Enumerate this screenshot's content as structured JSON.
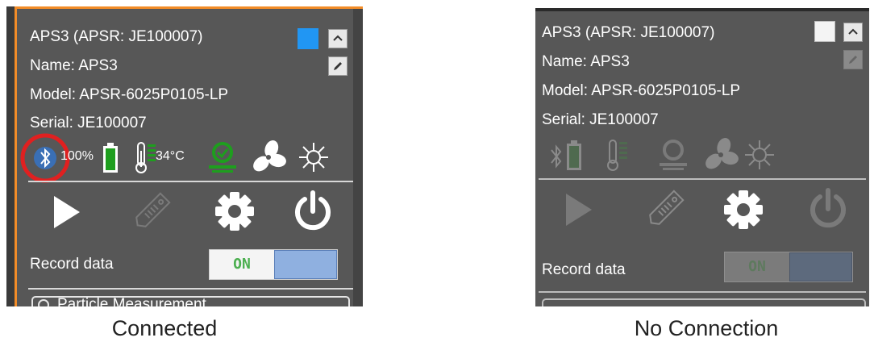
{
  "connected": {
    "title": "APS3 (APSR: JE100007)",
    "name": "Name:  APS3",
    "model": "Model: APSR-6025P0105-LP",
    "serial": "Serial:  JE100007",
    "battery": "100%",
    "temperature": "34°C",
    "record_label": "Record data",
    "toggle_label": "ON",
    "bottom_label": "Particle Measurement",
    "caption": "Connected",
    "colors": {
      "panel": "#575757",
      "accent_orange": "#f28c28",
      "color_square": "#2196f3",
      "bluetooth": "#3b82f6",
      "annotation": "#e02020",
      "status_green": "#1a9a1a",
      "toggle_on_text": "#4caf50",
      "toggle_knob": "#8fb0e0"
    }
  },
  "disconnected": {
    "title": "APS3 (APSR: JE100007)",
    "name": "Name:  APS3",
    "model": "Model: APSR-6025P0105-LP",
    "serial": "Serial:  JE100007",
    "record_label": "Record data",
    "toggle_label": "ON",
    "caption": "No Connection",
    "colors": {
      "panel": "#575757",
      "color_square": "#f4f4f4",
      "dim_green": "#4f6a4f",
      "toggle_knob": "#5d6a7d"
    }
  },
  "icons": [
    "bluetooth-icon",
    "battery-icon",
    "thermometer-icon",
    "sensor-icon",
    "fan-icon",
    "light-icon",
    "play-icon",
    "tag-icon",
    "gear-icon",
    "power-icon",
    "pencil-icon",
    "chevron-up-icon"
  ]
}
